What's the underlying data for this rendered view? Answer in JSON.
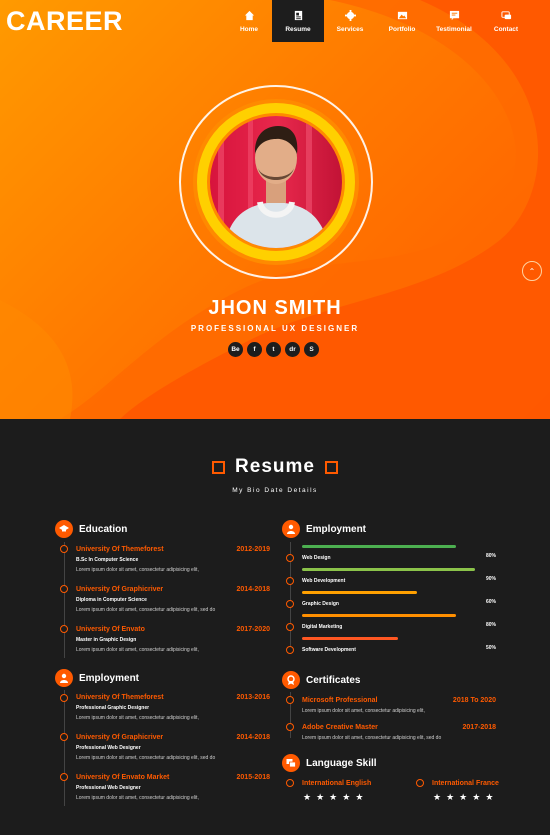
{
  "logo": "CAREER",
  "nav": [
    {
      "label": "Home",
      "icon": "home-icon"
    },
    {
      "label": "Resume",
      "icon": "resume-icon",
      "active": true
    },
    {
      "label": "Services",
      "icon": "gear-icon"
    },
    {
      "label": "Portfolio",
      "icon": "image-icon"
    },
    {
      "label": "Testimonial",
      "icon": "testimonial-icon"
    },
    {
      "label": "Contact",
      "icon": "chat-icon"
    }
  ],
  "hero": {
    "name": "JHON SMITH",
    "title": "PROFESSIONAL UX DESIGNER",
    "social": [
      "Be",
      "f",
      "t",
      "dr",
      "S"
    ]
  },
  "resume": {
    "title": "Resume",
    "subtitle": "My Bio Date Details"
  },
  "education": {
    "title": "Education",
    "items": [
      {
        "org": "University Of Themeforest",
        "years": "2012-2019",
        "degree": "B.Sc In Computer Science",
        "desc": "Lorem ipsum dolor sit amet, consectetur adipisicing elit,"
      },
      {
        "org": "University Of Graphicriver",
        "years": "2014-2018",
        "degree": "Diploma in Computer Science",
        "desc": "Lorem ipsum dolor sit amet, consectetur adipisicing elit, sed do"
      },
      {
        "org": "University Of Envato",
        "years": "2017-2020",
        "degree": "Master in Graphic Design",
        "desc": "Lorem ipsum dolor sit amet, consectetur adipisicing elit,"
      }
    ]
  },
  "employment_left": {
    "title": "Employment",
    "items": [
      {
        "org": "University Of Themeforest",
        "years": "2013-2016",
        "degree": "Professional Graphic Designer",
        "desc": "Lorem ipsum dolor sit amet, consectetur adipisicing elit,"
      },
      {
        "org": "University Of Graphicriver",
        "years": "2014-2018",
        "degree": "Professional Web Designer",
        "desc": "Lorem ipsum dolor sit amet, consectetur adipisicing elit, sed do"
      },
      {
        "org": "University Of Envato Market",
        "years": "2015-2018",
        "degree": "Professional Web Designer",
        "desc": "Lorem ipsum dolor sit amet, consectetur adipisicing elit,"
      }
    ]
  },
  "employment_right": {
    "title": "Employment",
    "skills": [
      {
        "label": "Web Design",
        "pct": "80%",
        "fill": 0.8,
        "color": "#4caf50"
      },
      {
        "label": "Web Development",
        "pct": "90%",
        "fill": 0.9,
        "color": "#8bc34a"
      },
      {
        "label": "Graphic Design",
        "pct": "60%",
        "fill": 0.6,
        "color": "#ffa000"
      },
      {
        "label": "Digital Marketing",
        "pct": "80%",
        "fill": 0.8,
        "color": "#ff8f00"
      },
      {
        "label": "Software Development",
        "pct": "50%",
        "fill": 0.5,
        "color": "#ff5722"
      }
    ]
  },
  "certificates": {
    "title": "Certificates",
    "items": [
      {
        "org": "Microsoft Professional",
        "years": "2018 To 2020",
        "desc": "Lorem ipsum dolor sit amet, consectetur adipisicing elit,"
      },
      {
        "org": "Adobe Creative Master",
        "years": "2017-2018",
        "desc": "Lorem ipsum dolor sit amet, consectetur adipisicing elit, sed do"
      }
    ]
  },
  "languages": {
    "title": "Language Skill",
    "items": [
      {
        "label": "International English",
        "stars": 5
      },
      {
        "label": "International France",
        "stars": 5
      }
    ]
  },
  "colors": {
    "accent": "#ff5a00",
    "dark": "#1c1c1c"
  }
}
